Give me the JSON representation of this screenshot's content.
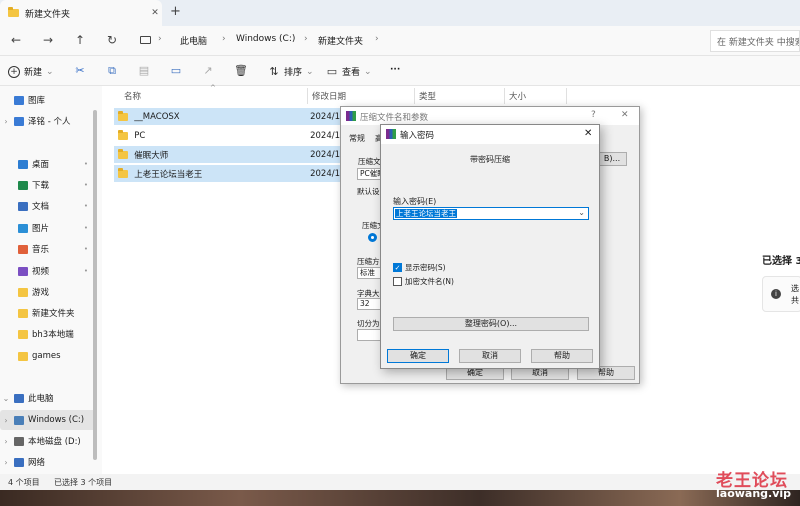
{
  "window": {
    "tab_title": "新建文件夹",
    "tab_close": "✕",
    "new_tab": "+"
  },
  "nav": {
    "back": "←",
    "forward": "→",
    "up": "↑",
    "refresh": "↻",
    "crumbs": [
      "此电脑",
      "Windows (C:)",
      "新建文件夹"
    ],
    "search_placeholder": "在 新建文件夹 中搜索"
  },
  "commands": {
    "new": "新建",
    "sort": "排序",
    "view": "查看",
    "more": "···"
  },
  "sidebar": [
    {
      "label": "图库",
      "chev": "",
      "pin": ""
    },
    {
      "label": "泽铭 - 个人",
      "chev": "›",
      "pin": ""
    },
    {
      "label": "桌面",
      "chev": "",
      "pin": "📌"
    },
    {
      "label": "下载",
      "chev": "",
      "pin": "📌"
    },
    {
      "label": "文档",
      "chev": "",
      "pin": "📌"
    },
    {
      "label": "图片",
      "chev": "",
      "pin": "📌"
    },
    {
      "label": "音乐",
      "chev": "",
      "pin": "📌"
    },
    {
      "label": "视频",
      "chev": "",
      "pin": "📌"
    },
    {
      "label": "游戏",
      "chev": "",
      "pin": ""
    },
    {
      "label": "新建文件夹",
      "chev": "",
      "pin": ""
    },
    {
      "label": "bh3本地端",
      "chev": "",
      "pin": ""
    },
    {
      "label": "games",
      "chev": "",
      "pin": ""
    },
    {
      "label": "此电脑",
      "chev": "⌄",
      "pin": ""
    },
    {
      "label": "Windows (C:)",
      "chev": "›",
      "pin": ""
    },
    {
      "label": "本地磁盘 (D:)",
      "chev": "›",
      "pin": ""
    },
    {
      "label": "网络",
      "chev": "›",
      "pin": ""
    }
  ],
  "columns": {
    "name": "名称",
    "date": "修改日期",
    "type": "类型",
    "size": "大小",
    "sort_indicator": "^"
  },
  "files": [
    {
      "name": "__MACOSX",
      "date": "2024/1"
    },
    {
      "name": "PC",
      "date": "2024/1"
    },
    {
      "name": "催眠大师",
      "date": "2024/1"
    },
    {
      "name": "上老王论坛当老王",
      "date": "2024/1"
    }
  ],
  "details": {
    "selected": "已选择 3",
    "info_1": "选",
    "info_2": "共"
  },
  "status": {
    "count": "4 个项目",
    "selected": "已选择 3 个项目"
  },
  "archive_dialog": {
    "title": "压缩文件名和参数",
    "help": "?",
    "close": "✕",
    "tabs": [
      "常规",
      "高"
    ],
    "name_label": "压缩文件",
    "name_value": "PC催眠",
    "browse": "B)...",
    "profile_label": "默认设置",
    "format_label": "压缩文",
    "method_label": "压缩方式",
    "method_value": "标准",
    "dict_label": "字典大小",
    "dict_value": "32",
    "split_label": "切分为分卷",
    "ok": "确定",
    "cancel": "取消",
    "help_btn": "帮助"
  },
  "password_dialog": {
    "title": "输入密码",
    "close": "✕",
    "heading": "带密码压缩",
    "input_label": "输入密码(E)",
    "input_value": "上老王论坛当老王",
    "show_password": "显示密码(S)",
    "encrypt_names": "加密文件名(N)",
    "organize": "整理密码(O)...",
    "ok": "确定",
    "cancel": "取消",
    "help": "帮助"
  },
  "watermark": {
    "line1": "老王论坛",
    "line2": "laowang.vip"
  },
  "colors": {
    "accent": "#0078d7",
    "selection": "#cce4f7",
    "folder": "#f4c542"
  }
}
